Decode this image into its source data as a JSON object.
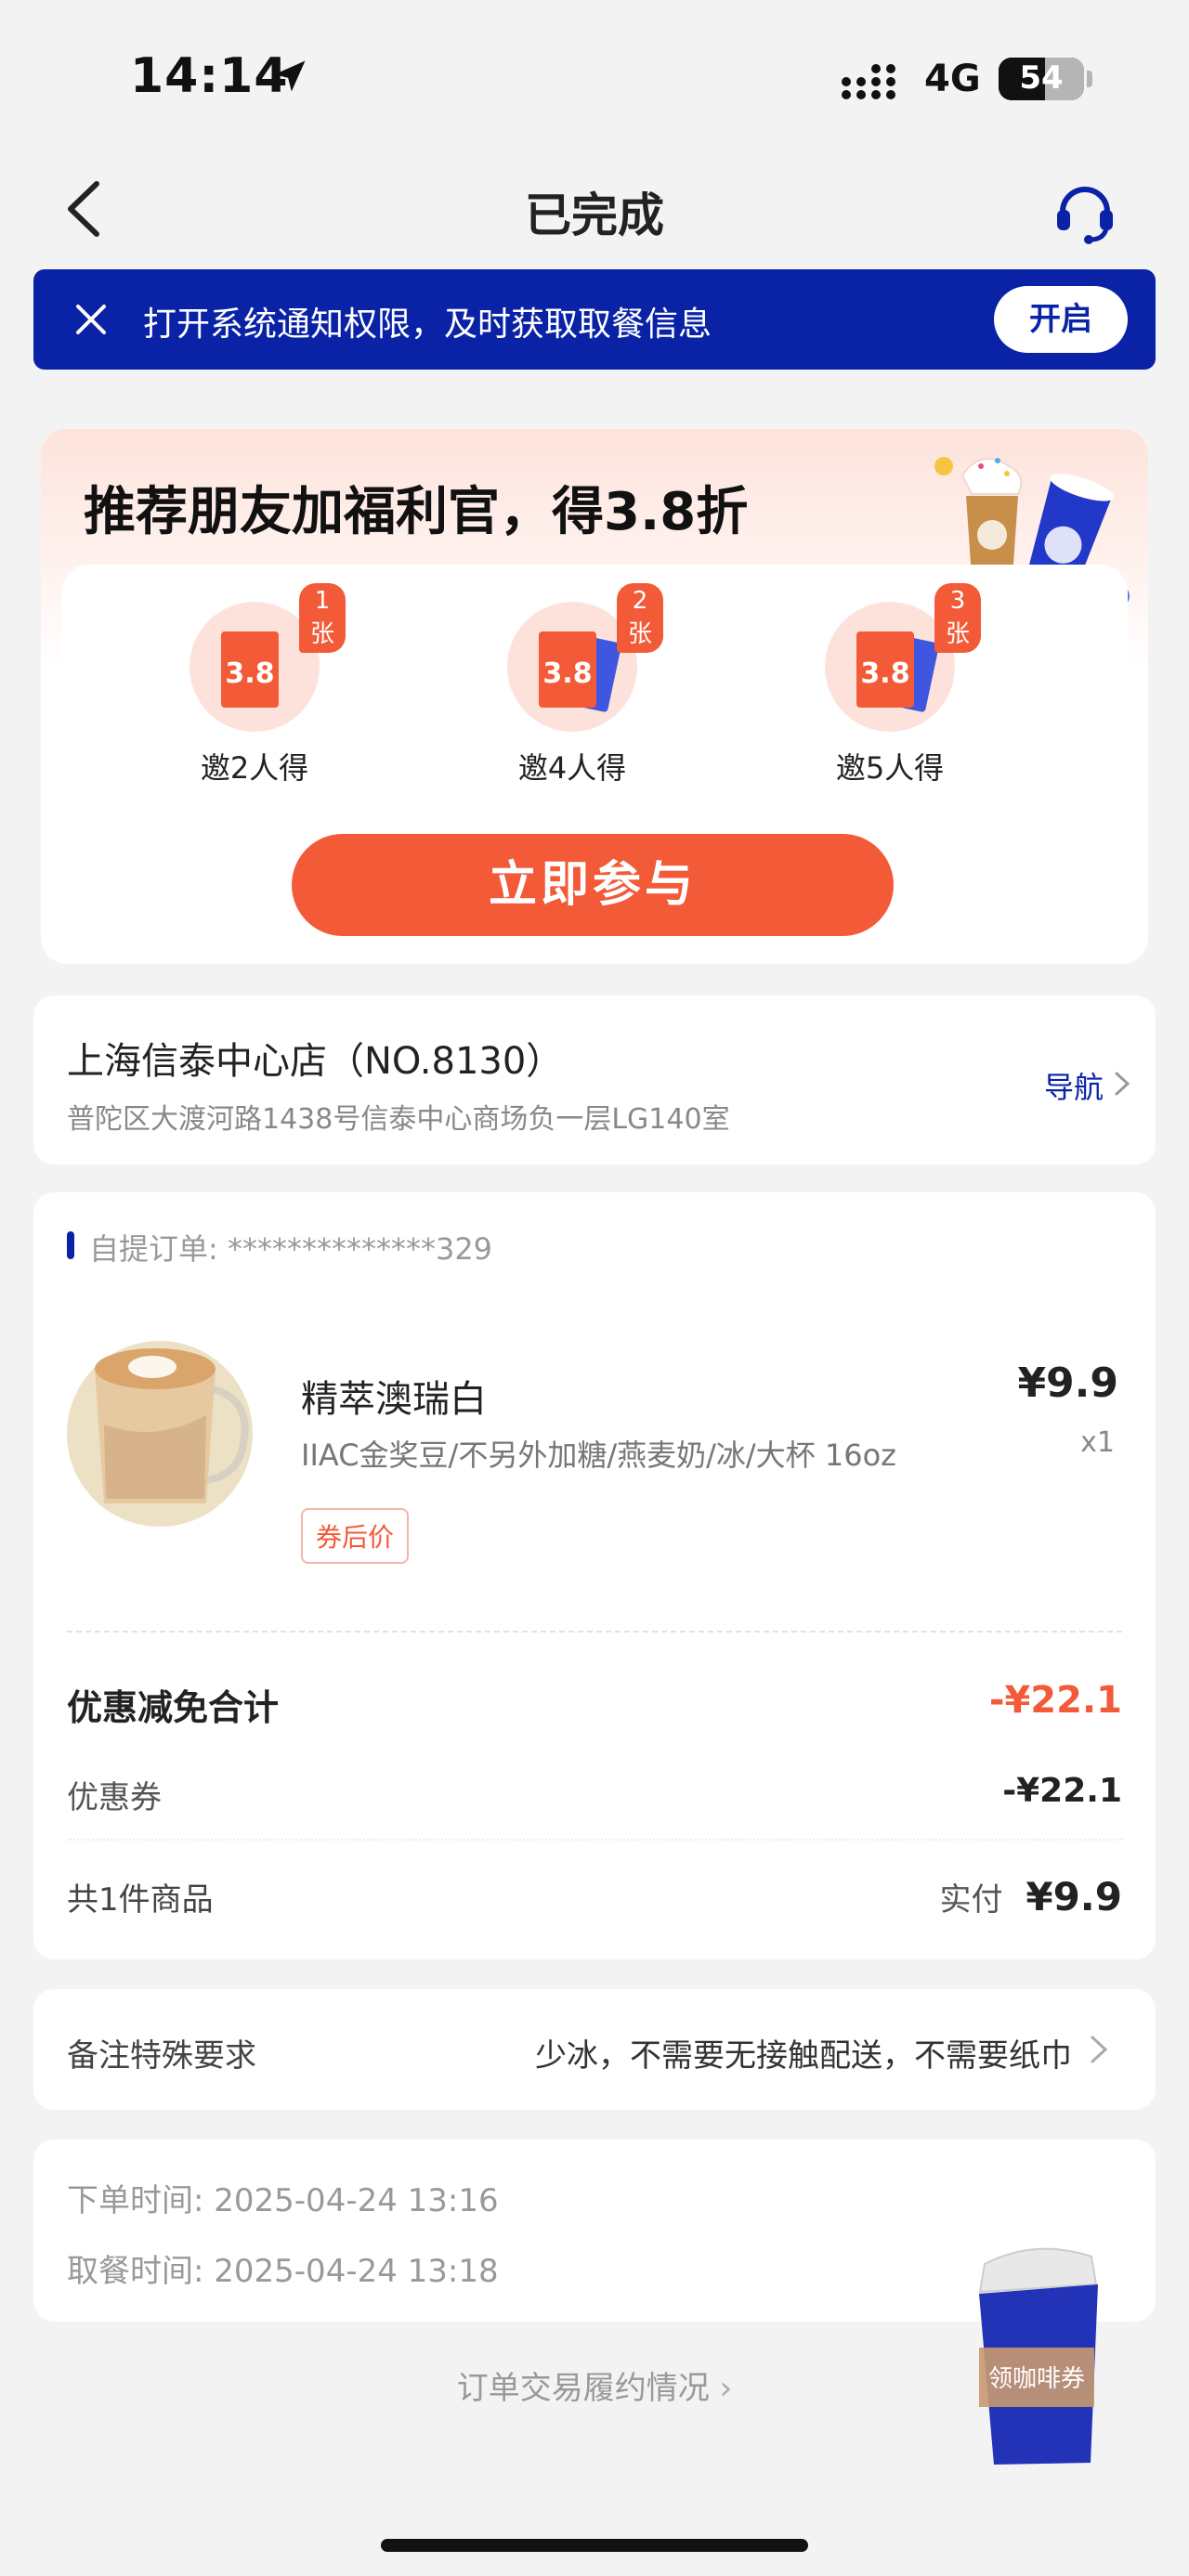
{
  "status_bar": {
    "time": "14:14",
    "network": "4G",
    "battery": "54",
    "battery_level": 0.54
  },
  "header": {
    "title": "已完成"
  },
  "notice": {
    "text": "打开系统通知权限，及时获取取餐信息",
    "button": "开启"
  },
  "promo": {
    "title": "推荐朋友加福利官，得3.8折",
    "ticket_value": "3.8",
    "tiers": [
      {
        "badge": "1张",
        "caption": "邀2人得"
      },
      {
        "badge": "2张",
        "caption": "邀4人得"
      },
      {
        "badge": "3张",
        "caption": "邀5人得"
      }
    ],
    "button": "立即参与"
  },
  "store": {
    "name": "上海信泰中心店（NO.8130）",
    "address": "普陀区大渡河路1438号信泰中心商场负一层LG140室",
    "nav": "导航"
  },
  "order": {
    "label": "自提订单: **************329",
    "product": {
      "name": "精萃澳瑞白",
      "spec": "IIAC金奖豆/不另外加糖/燕麦奶/冰/大杯 16oz",
      "tag": "券后价",
      "price": "¥9.9",
      "qty": "x1"
    },
    "discount_total_label": "优惠减免合计",
    "discount_total": "-¥22.1",
    "coupon_label": "优惠券",
    "coupon_value": "-¥22.1",
    "count_label": "共1件商品",
    "paid_label": "实付",
    "paid_value": "¥9.9"
  },
  "remark": {
    "label": "备注特殊要求",
    "value": "少冰，不需要无接触配送，不需要纸巾"
  },
  "times": {
    "order_time": "下单时间:  2025-04-24 13:16",
    "pickup_time": "取餐时间:  2025-04-24 13:18"
  },
  "trade_link": "订单交易履约情况",
  "float_coupon": "领咖啡券",
  "colors": {
    "brand_blue": "#0a23a6",
    "accent_orange": "#f25a38"
  }
}
